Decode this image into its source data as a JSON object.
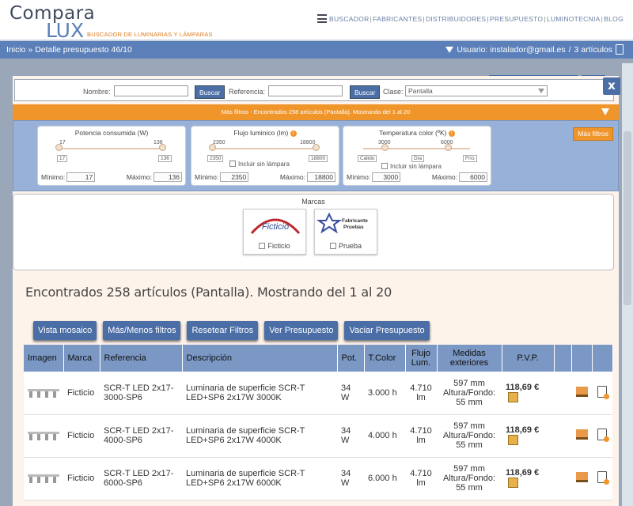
{
  "header": {
    "logo_word1": "Compara",
    "logo_word2": "LUX",
    "logo_tagline": "BUSCADOR DE LUMINARIAS Y LÁMPARAS",
    "nav": [
      "BUSCADOR",
      "FABRICANTES",
      "DISTRIBUIDORES",
      "PRESUPUESTO",
      "LUMINOTECNIA",
      "BLOG"
    ]
  },
  "breadcrumb": {
    "home": "Inicio",
    "sep": "»",
    "current": "Detalle presupuesto 46/10",
    "user": "Usuario: instalador@gmail.es",
    "slash": "/",
    "count": "3 artículos"
  },
  "modal": {
    "close": "x",
    "search": {
      "name_label": "Nombre:",
      "name_value": "",
      "search_button": "Buscar",
      "ref_label": "Referencia:",
      "ref_value": "",
      "search_button2": "Buscar",
      "class_label": "Clase:",
      "class_value": "Pantalla"
    },
    "more_filters_bar": "Más filtros - Encontrados 258 artículos (Pantalla). Mostrando del 1 al 20",
    "more_filters_button": "Más filtros",
    "sliders": [
      {
        "title": "Potencia consumida (W)",
        "tick_min": "17",
        "tick_max": "136",
        "box_min": "17",
        "box_max": "136",
        "min_label": "Mínimo:",
        "max_label": "Máximo:",
        "min": "17",
        "max": "136"
      },
      {
        "title": "Flujo luminico (lm)",
        "tick_min": "2350",
        "tick_max": "18800",
        "box_min": "2350",
        "box_max": "18800",
        "check_label": "Incluir sin lámpara",
        "min_label": "Mínimo:",
        "max_label": "Máximo:",
        "min": "2350",
        "max": "18800"
      },
      {
        "title": "Temperatura color (ºK)",
        "tick_min": "3000",
        "tick_max": "6000",
        "box1": "Cálido",
        "box2": "Día",
        "box3": "Frío",
        "check_label": "Incluir sin lámpara",
        "min_label": "Mínimo:",
        "max_label": "Máximo:",
        "min": "3000",
        "max": "6000"
      }
    ],
    "brands_title": "Marcas",
    "brands": [
      {
        "logo_text": "Ficticio",
        "label": "Ficticio"
      },
      {
        "logo_text_1": "Fabricante",
        "logo_text_2": "Pruebas",
        "label": "Prueba"
      }
    ],
    "results_text": "Encontrados 258 artículos (Pantalla). Mostrando del 1 al 20",
    "actions": [
      "Vista mosaico",
      "Más/Menos filtros",
      "Resetear Filtros",
      "Ver Presupuesto",
      "Vaciar Presupuesto"
    ],
    "table": {
      "headers": [
        "Imagen",
        "Marca",
        "Referencia",
        "Descripción",
        "Pot.",
        "T.Color",
        "Flujo Lum.",
        "Medidas exteriores",
        "P.V.P.",
        "",
        "",
        ""
      ],
      "rows": [
        {
          "brand": "Ficticio",
          "ref": "SCR-T LED 2x17-3000-SP6",
          "desc": "Luminaria de superficie SCR-T LED+SP6 2x17W 3000K",
          "pot": "34 W",
          "tcolor": "3.000 h",
          "flujo": "4.710 lm",
          "medidas": "597 mm Altura/Fondo: 55 mm",
          "pvp": "118,69 €"
        },
        {
          "brand": "Ficticio",
          "ref": "SCR-T LED 2x17-4000-SP6",
          "desc": "Luminaria de superficie SCR-T LED+SP6 2x17W 4000K",
          "pot": "34 W",
          "tcolor": "4.000 h",
          "flujo": "4.710 lm",
          "medidas": "597 mm Altura/Fondo: 55 mm",
          "pvp": "118,69 €"
        },
        {
          "brand": "Ficticio",
          "ref": "SCR-T LED 2x17-6000-SP6",
          "desc": "Luminaria de superficie SCR-T LED+SP6 2x17W 6000K",
          "pot": "34 W",
          "tcolor": "6.000 h",
          "flujo": "4.710 lm",
          "medidas": "597 mm Altura/Fondo: 55 mm",
          "pvp": "118,69 €"
        }
      ]
    }
  }
}
